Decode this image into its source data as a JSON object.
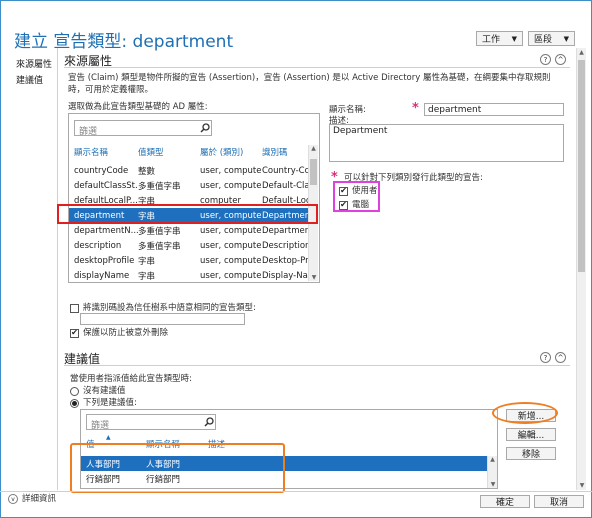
{
  "header": {
    "title": "建立 宣告類型: department",
    "tasks_label": "工作",
    "sections_label": "區段"
  },
  "nav": {
    "items": [
      {
        "label": "來源屬性"
      },
      {
        "label": "建議值"
      }
    ]
  },
  "source_section": {
    "title": "來源屬性",
    "description": "宣告 (Claim) 類型是物件所擬的宣告 (Assertion)，宣告 (Assertion) 是以 Active Directory 屬性為基礎，在綱要集中存取規則時，可用於定義權限。",
    "select_label": "選取做為此宣告類型基礎的 AD 屬性:",
    "search_placeholder": "篩選",
    "columns": [
      "顯示名稱",
      "值類型",
      "屬於 (類別)",
      "識別碼"
    ],
    "rows": [
      {
        "name": "countryCode",
        "type": "整數",
        "class": "user, computer",
        "id": "Country-Code"
      },
      {
        "name": "defaultClassSt...",
        "type": "多重值字串",
        "class": "user, computer",
        "id": "Default-Class"
      },
      {
        "name": "defaultLocalP...",
        "type": "字串",
        "class": "computer",
        "id": "Default-Local"
      },
      {
        "name": "department",
        "type": "字串",
        "class": "user, computer",
        "id": "Department",
        "selected": true
      },
      {
        "name": "departmentN...",
        "type": "多重值字串",
        "class": "user, computer",
        "id": "Department-N"
      },
      {
        "name": "description",
        "type": "多重值字串",
        "class": "user, computer",
        "id": "Description"
      },
      {
        "name": "desktopProfile",
        "type": "字串",
        "class": "user, computer",
        "id": "Desktop-Profi"
      },
      {
        "name": "displayName",
        "type": "字串",
        "class": "user, computer",
        "id": "Display-Name"
      }
    ],
    "display_name_label": "顯示名稱:",
    "display_name_value": "department",
    "description_label": "描述:",
    "description_value": "Department",
    "issue_label": "可以針對下列類別發行此類型的宣告:",
    "issue_options": [
      {
        "label": "使用者",
        "checked": true
      },
      {
        "label": "電腦",
        "checked": true
      }
    ],
    "trust_checkbox_label": "將識別碼設為信任樹系中語意相同的宣告類型:",
    "protect_checkbox_label": "保護以防止被意外刪除"
  },
  "suggested_section": {
    "title": "建議值",
    "prompt": "當使用者指派值給此宣告類型時:",
    "radio_none": "沒有建議值",
    "radio_following": "下列是建議值:",
    "search_placeholder": "篩選",
    "columns": [
      "值",
      "顯示名稱",
      "描述"
    ],
    "rows": [
      {
        "value": "人事部門",
        "display": "人事部門",
        "desc": "",
        "selected": true
      },
      {
        "value": "行銷部門",
        "display": "行銷部門",
        "desc": ""
      }
    ],
    "add_button": "新增...",
    "edit_button": "編輯...",
    "remove_button": "移除"
  },
  "footer": {
    "details_label": "詳細資訊",
    "ok_label": "確定",
    "cancel_label": "取消"
  },
  "colors": {
    "accent": "#1e6fb4",
    "selection": "#1f6fbf",
    "highlight_red": "#e02020",
    "highlight_pink": "#e040e0",
    "highlight_orange": "#ef7d22"
  }
}
